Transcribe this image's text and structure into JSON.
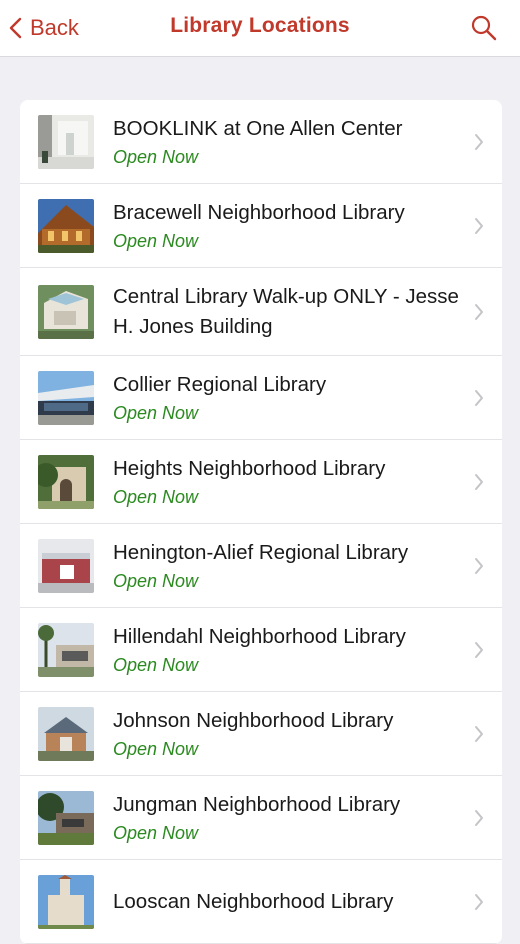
{
  "navbar": {
    "back_label": "Back",
    "title": "Library Locations",
    "accent_color": "#c0392b"
  },
  "locations": [
    {
      "name": "BOOKLINK at One Allen Center",
      "status": "Open Now"
    },
    {
      "name": "Bracewell Neighborhood Library",
      "status": "Open Now"
    },
    {
      "name": "Central Library Walk-up ONLY - Jesse H. Jones Building",
      "status": ""
    },
    {
      "name": "Collier Regional Library",
      "status": "Open Now"
    },
    {
      "name": "Heights Neighborhood Library",
      "status": "Open Now"
    },
    {
      "name": "Henington-Alief Regional Library",
      "status": "Open Now"
    },
    {
      "name": "Hillendahl Neighborhood Library",
      "status": "Open Now"
    },
    {
      "name": "Johnson Neighborhood Library",
      "status": "Open Now"
    },
    {
      "name": "Jungman Neighborhood Library",
      "status": "Open Now"
    },
    {
      "name": "Looscan Neighborhood Library",
      "status": ""
    }
  ]
}
